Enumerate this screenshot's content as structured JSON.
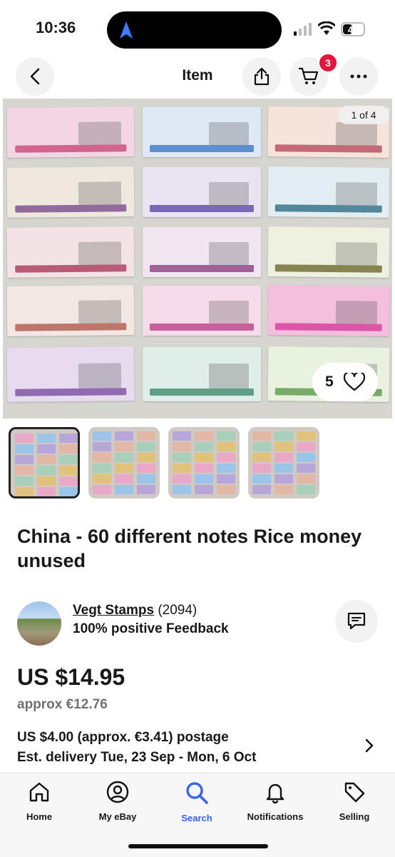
{
  "status_bar": {
    "time": "10:36",
    "battery": "45",
    "battery_level": 0.45
  },
  "topbar": {
    "title": "Item",
    "cart_count": "3",
    "icons": [
      "back-icon",
      "share-icon",
      "cart-icon",
      "more-icon"
    ]
  },
  "gallery": {
    "counter": "1 of 4",
    "watch_count": "5",
    "thumb_count": 4
  },
  "product": {
    "title": "China - 60 different notes Rice money unused"
  },
  "seller": {
    "name": "Vegt Stamps",
    "rating_count": "(2094)",
    "feedback": "100% positive Feedback"
  },
  "pricing": {
    "price": "US $14.95",
    "approx": "approx €12.76"
  },
  "shipping": {
    "postage": "US $4.00 (approx. €3.41) postage",
    "delivery": "Est. delivery Tue, 23 Sep - Mon, 6 Oct"
  },
  "bottom_nav": [
    {
      "label": "Home",
      "icon": "home-icon"
    },
    {
      "label": "My eBay",
      "icon": "user-icon"
    },
    {
      "label": "Search",
      "icon": "search-icon",
      "active": true
    },
    {
      "label": "Notifications",
      "icon": "bell-icon"
    },
    {
      "label": "Selling",
      "icon": "tag-icon"
    }
  ],
  "colors": {
    "accent": "#3665f3",
    "badge": "#e0173e"
  }
}
